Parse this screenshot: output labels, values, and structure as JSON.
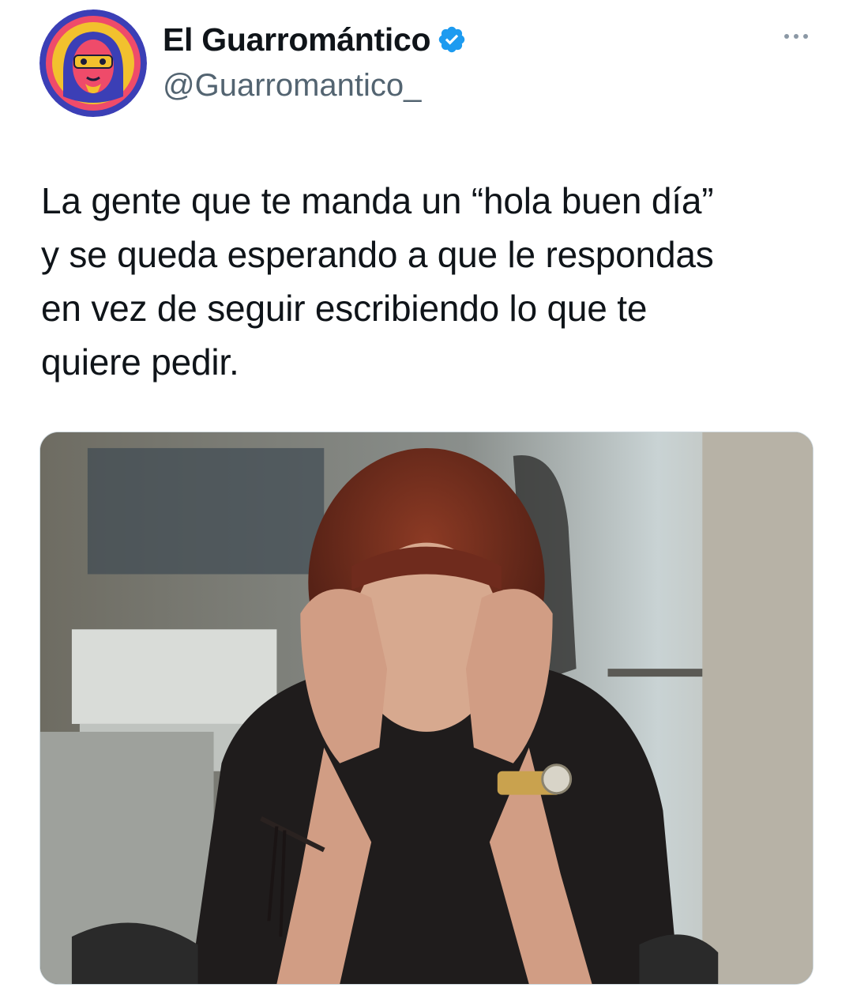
{
  "author": {
    "display_name": "El Guarromántico",
    "handle": "@Guarromantico_",
    "verified": true,
    "avatar_icon": "illustrated-face-avatar",
    "verified_icon": "verified-badge-icon",
    "verified_color": "#1d9bf0"
  },
  "menu": {
    "icon": "more-options-icon"
  },
  "tweet": {
    "text_lines": [
      "La gente que te manda un “hola buen día”",
      "y se queda esperando a que le respondas",
      "en vez de seguir escribiendo lo que te",
      "quiere pedir."
    ]
  },
  "media": {
    "type": "photo"
  },
  "colors": {
    "text": "#0f1419",
    "secondary_text": "#536471",
    "background": "#ffffff"
  }
}
